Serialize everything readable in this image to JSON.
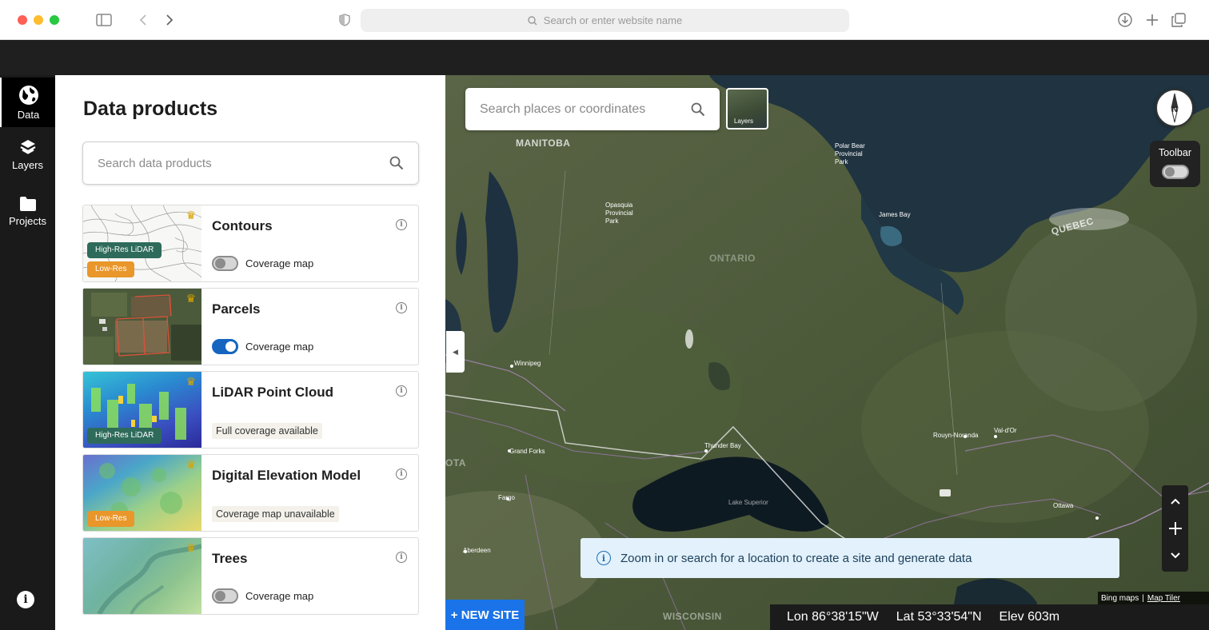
{
  "browser": {
    "url_placeholder": "Search or enter website name"
  },
  "rail": {
    "items": [
      {
        "label": "Data",
        "icon": "globe-icon"
      },
      {
        "label": "Layers",
        "icon": "layers-icon"
      },
      {
        "label": "Projects",
        "icon": "folder-icon"
      }
    ],
    "info_icon": "i"
  },
  "panel": {
    "title": "Data products",
    "search_placeholder": "Search data products",
    "cards": [
      {
        "title": "Contours",
        "badges": [
          "High-Res LiDAR",
          "Low-Res"
        ],
        "toggle_label": "Coverage map",
        "toggle_on": false
      },
      {
        "title": "Parcels",
        "badges": [],
        "toggle_label": "Coverage map",
        "toggle_on": true
      },
      {
        "title": "LiDAR Point Cloud",
        "badges": [
          "High-Res LiDAR"
        ],
        "status": "Full coverage available"
      },
      {
        "title": "Digital Elevation Model",
        "badges": [
          "Low-Res"
        ],
        "status": "Coverage map unavailable"
      },
      {
        "title": "Trees",
        "badges": [],
        "toggle_label": "Coverage map",
        "toggle_on": false
      }
    ]
  },
  "map": {
    "search_placeholder": "Search places or coordinates",
    "layers_label": "Layers",
    "compass_label": "N",
    "toolbar_label": "Toolbar",
    "notice": "Zoom in or search for a location to create a site and generate data",
    "new_site": "+ NEW SITE",
    "coords": {
      "lon": "Lon 86°38'15\"W",
      "lat": "Lat 53°33'54\"N",
      "elev": "Elev 603m"
    },
    "attribution": {
      "bing": "Bing maps",
      "sep": "|",
      "tiler": "Map Tiler"
    },
    "labels": {
      "manitoba": "MANITOBA",
      "ontario": "ONTARIO",
      "quebec": "QUEBEC",
      "james_bay": "James Bay",
      "winnipeg": "Winnipeg",
      "thunder_bay": "Thunder Bay",
      "grand_forks": "Grand Forks",
      "fargo": "Fargo",
      "aberdeen": "Aberdeen",
      "wisconsin": "WISCONSIN",
      "ota": "OTA",
      "ottawa": "Ottawa",
      "rouyn": "Rouyn-Noranda",
      "val_dor": "Val-d'Or",
      "polar_bear": "Polar Bear Provincial Park",
      "opasquia": "Opasquia Provincial Park",
      "lake_superior": "Lake Superior"
    }
  },
  "colors": {
    "accent": "#1a73e8",
    "toggle_on": "#1565c0",
    "high_res_badge": "#2e6b5a",
    "low_res_badge": "#e9962a",
    "notice_bg": "#e2f1fb"
  }
}
